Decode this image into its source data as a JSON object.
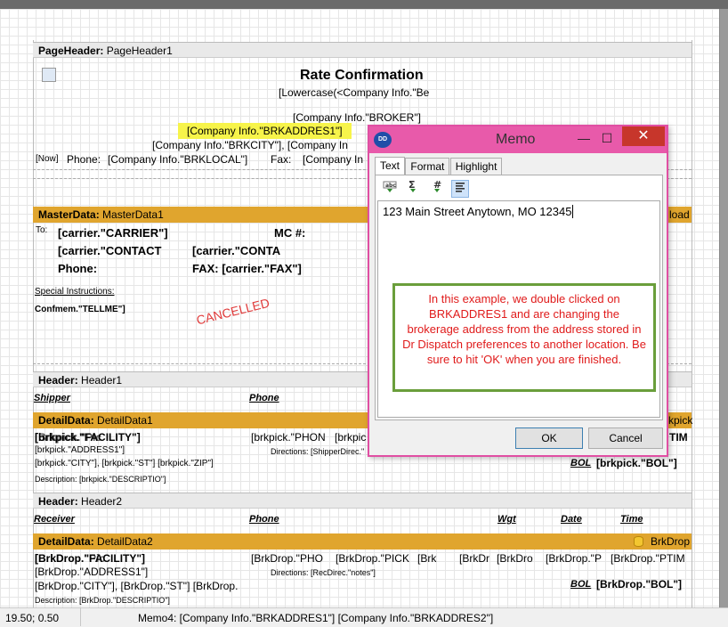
{
  "report": {
    "page_header": {
      "band_type": "PageHeader:",
      "band_name": "PageHeader1",
      "title": "Rate Confirmation",
      "lowercase_field": "[Lowercase(<Company Info.\"Be",
      "broker_field": "[Company Info.\"BROKER\"]",
      "address_field": "[Company Info.\"BRKADDRES1\"]",
      "city_field": "[Company Info.\"BRKCITY\"], [Company In",
      "now_field": "[Now]",
      "phone_label": "Phone:",
      "local_field": "[Company Info.\"BRKLOCAL\"]",
      "fax_label": "Fax:",
      "fax_field": "[Company In"
    },
    "master_data": {
      "band_type": "MasterData:",
      "band_name": "MasterData1",
      "right_label": "load",
      "to_label": "To:",
      "carrier_field": "[carrier.\"CARRIER\"]",
      "contact_field": "[carrier.\"CONTACT",
      "contact_field2": "[carrier.\"CONTA",
      "phone_label": "Phone:",
      "mc_label": "MC #:",
      "fax_field": "FAX: [carrier.\"FAX\"]",
      "special_label": "Special Instructions:",
      "tellme_field": "Confmem.\"TELLME\"]",
      "cancelled": "CANCELLED"
    },
    "header1": {
      "band_type": "Header:",
      "band_name": "Header1",
      "shipper": "Shipper",
      "phone": "Phone"
    },
    "detail1": {
      "band_type": "DetailData:",
      "band_name": "DetailData1",
      "right_label": "kpick",
      "facility_field": "[brkpick.\"FACILITY\"]",
      "overlap_text": "[Brkpick.\"Pic",
      "phone_field": "[brkpick.\"PHON",
      "phone_field2": "[brkpic",
      "time_field": "TIM",
      "address_field": "[brkpick.\"ADDRESS1\"]",
      "directions_field": "Directions: [ShipperDirec.\"",
      "city_field": "[brkpick.\"CITY\"], [brkpick.\"ST\"] [brkpick.\"ZIP\"]",
      "bol_label": "BOL",
      "bol_field": "[brkpick.\"BOL\"]",
      "description_field": "Description: [brkpick.\"DESCRIPTIO\"]"
    },
    "header2": {
      "band_type": "Header:",
      "band_name": "Header2",
      "receiver": "Receiver",
      "phone": "Phone",
      "wgt": "Wgt",
      "date": "Date",
      "time": "Time"
    },
    "detail2": {
      "band_type": "DetailData:",
      "band_name": "DetailData2",
      "right_label": "BrkDrop",
      "facility_field": "[BrkDrop.\"FACILITY\"]",
      "overlap_text": "[BrkDrop.\"Pic",
      "phone_field": "[BrkDrop.\"PHO",
      "pick_field": "[BrkDrop.\"PICK",
      "brk": "[Brk",
      "brkdr": "[BrkDr",
      "brkdro": "[BrkDro",
      "brkdrop_p": "[BrkDrop.\"P",
      "brkdrop_ptim": "[BrkDrop.\"PTIM",
      "address_field": "[BrkDrop.\"ADDRESS1\"]",
      "directions_field": "Directions: [RecDirec.\"notes\"]",
      "city_field": "[BrkDrop.\"CITY\"], [BrkDrop.\"ST\"]  [BrkDrop.",
      "bol_label": "BOL",
      "bol_field": "[BrkDrop.\"BOL\"]",
      "description_field": "Description: [BrkDrop.\"DESCRIPTIO\"]"
    }
  },
  "dialog": {
    "title": "Memo",
    "minimize": "—",
    "maximize": "☐",
    "close": "✕",
    "tabs": [
      {
        "label": "Text"
      },
      {
        "label": "Format"
      },
      {
        "label": "Highlight"
      }
    ],
    "memo_text": "123 Main Street Anytown, MO 12345",
    "callout": "In this example, we double clicked on BRKADDRES1 and are changing the brokerage address from the address stored in Dr Dispatch preferences to another location. Be sure to hit 'OK' when you are finished.",
    "ok_label": "OK",
    "cancel_label": "Cancel"
  },
  "statusbar": {
    "coords": "19.50; 0.50",
    "memo_info": "Memo4: [Company Info.\"BRKADDRES1\"]   [Company Info.\"BRKADDRES2\"]"
  },
  "colors": {
    "titlebar": "#e85aaa",
    "close": "#c7362b",
    "band_orange": "#e0a52e",
    "highlight_yellow": "#f7f44a",
    "callout_text": "#e01b1b",
    "callout_border": "#6a9e3b"
  }
}
